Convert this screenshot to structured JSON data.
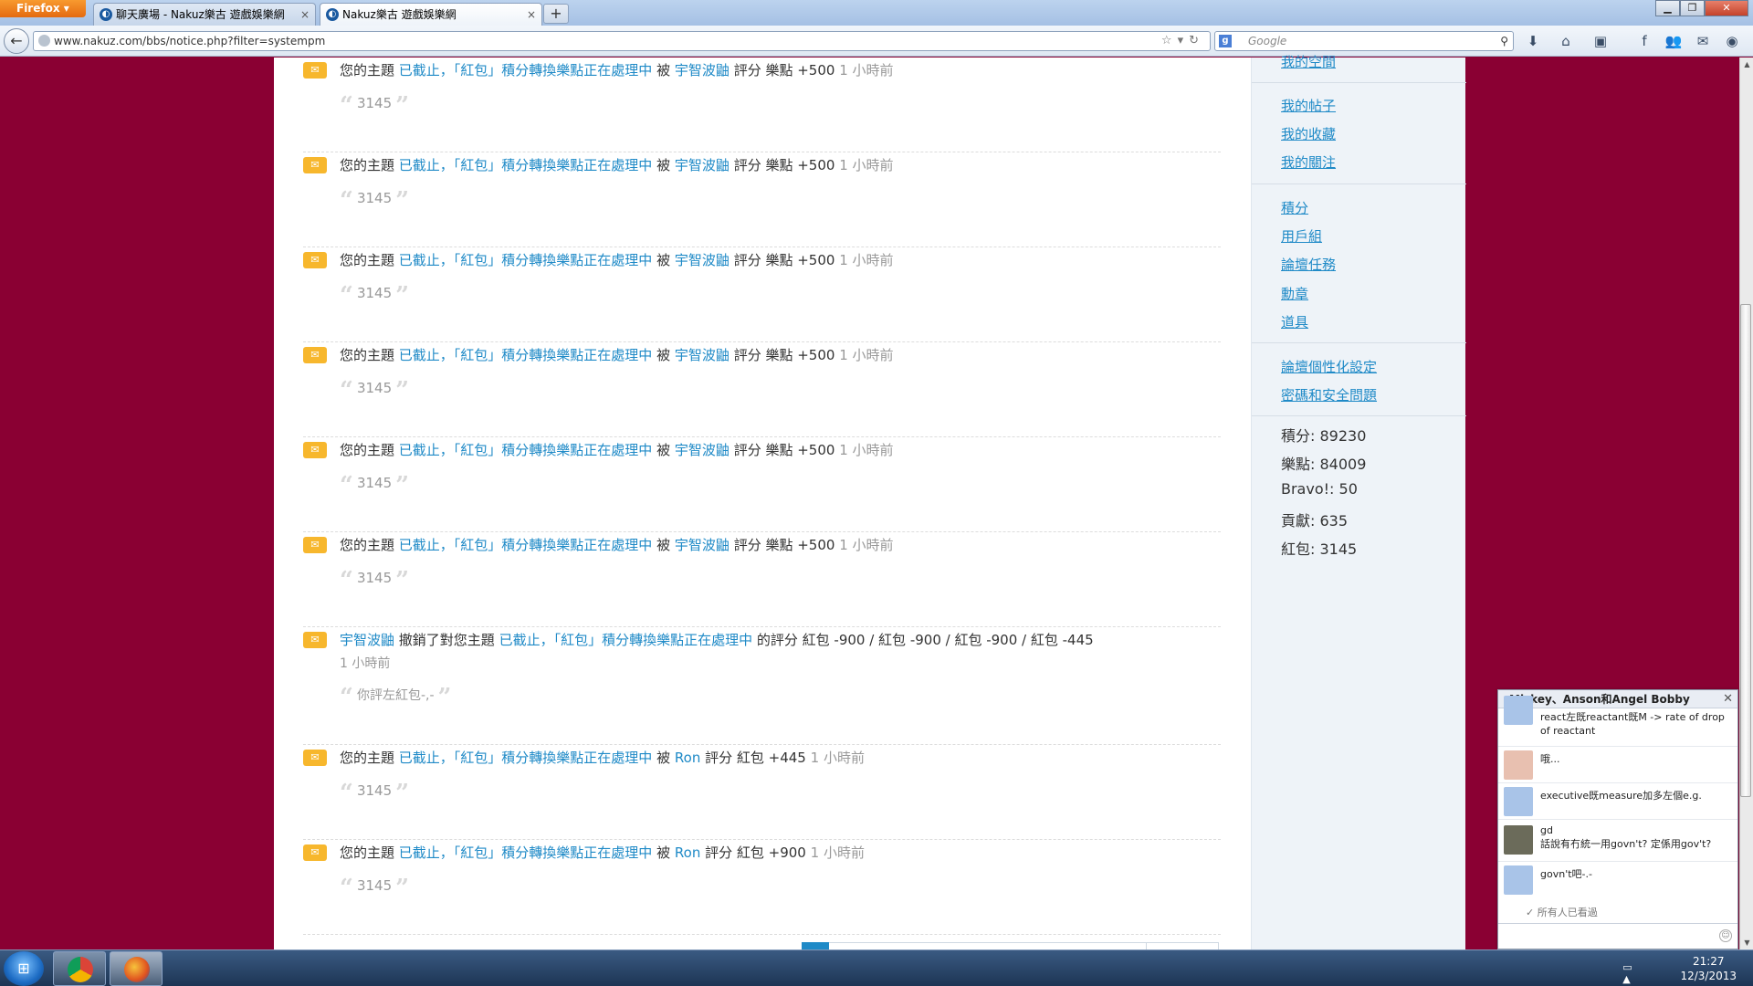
{
  "browser": {
    "app_button": "Firefox",
    "tabs": [
      {
        "title": "聊天廣場 - Nakuz樂古 遊戲娛樂網",
        "active": false
      },
      {
        "title": "Nakuz樂古 遊戲娛樂網",
        "active": true
      }
    ],
    "new_tab": "+",
    "url": "www.nakuz.com/bbs/notice.php?filter=systempm",
    "search_placeholder": "Google"
  },
  "notices": [
    {
      "pre": "您的主題",
      "topic": "已截止，「紅包」積分轉換樂點正在處理中",
      "by": "被",
      "user": "宇智波鼬",
      "action": "評分 樂點 +500",
      "time": "1 小時前",
      "quote": "3145"
    },
    {
      "pre": "您的主題",
      "topic": "已截止，「紅包」積分轉換樂點正在處理中",
      "by": "被",
      "user": "宇智波鼬",
      "action": "評分 樂點 +500",
      "time": "1 小時前",
      "quote": "3145"
    },
    {
      "pre": "您的主題",
      "topic": "已截止，「紅包」積分轉換樂點正在處理中",
      "by": "被",
      "user": "宇智波鼬",
      "action": "評分 樂點 +500",
      "time": "1 小時前",
      "quote": "3145"
    },
    {
      "pre": "您的主題",
      "topic": "已截止，「紅包」積分轉換樂點正在處理中",
      "by": "被",
      "user": "宇智波鼬",
      "action": "評分 樂點 +500",
      "time": "1 小時前",
      "quote": "3145"
    },
    {
      "pre": "您的主題",
      "topic": "已截止，「紅包」積分轉換樂點正在處理中",
      "by": "被",
      "user": "宇智波鼬",
      "action": "評分 樂點 +500",
      "time": "1 小時前",
      "quote": "3145"
    },
    {
      "pre": "您的主題",
      "topic": "已截止，「紅包」積分轉換樂點正在處理中",
      "by": "被",
      "user": "宇智波鼬",
      "action": "評分 樂點 +500",
      "time": "1 小時前",
      "quote": "3145"
    }
  ],
  "revoke_notice": {
    "user": "宇智波鼬",
    "mid": "撤銷了對您主題",
    "topic": "已截止，「紅包」積分轉換樂點正在處理中",
    "action": "的評分 紅包 -900 / 紅包 -900 / 紅包 -900 / 紅包 -445",
    "time": "1 小時前",
    "quote": "你評左紅包-,-"
  },
  "notices_ron": [
    {
      "pre": "您的主題",
      "topic": "已截止，「紅包」積分轉換樂點正在處理中",
      "by": "被",
      "user": "Ron",
      "action": "評分 紅包 +445",
      "time": "1 小時前",
      "quote": "3145"
    },
    {
      "pre": "您的主題",
      "topic": "已截止，「紅包」積分轉換樂點正在處理中",
      "by": "被",
      "user": "Ron",
      "action": "評分 紅包 +900",
      "time": "1 小時前",
      "quote": "3145"
    }
  ],
  "sidebar": {
    "group1": [
      "我的空間"
    ],
    "group2": [
      "我的帖子",
      "我的收藏",
      "我的關注"
    ],
    "group3": [
      "積分",
      "用戶組",
      "論壇任務",
      "勳章",
      "道具"
    ],
    "group4": [
      "論壇個性化設定",
      "密碼和安全問題"
    ],
    "stats": [
      "積分: 89230",
      "樂點: 84009",
      "Bravo!: 50",
      "貢獻: 635",
      "紅包: 3145"
    ]
  },
  "chat": {
    "title": "Mickey、Anson和Angel Bobby",
    "messages": [
      {
        "text": "react左既reactant既M -> rate of drop of reactant"
      },
      {
        "text": "哦..."
      },
      {
        "text": "executive既measure加多左個e.g."
      },
      {
        "text": "gd\n話說有冇統一用govn't? 定係用gov't?"
      },
      {
        "text": "govn't吧-.-"
      }
    ],
    "seen": "所有人已看過"
  },
  "taskbar": {
    "time": "21:27",
    "date": "12/3/2013"
  },
  "colors": {
    "page_bg": "#8a0033",
    "link": "#1f8ac7",
    "sidebar_bg": "#eef3f8"
  }
}
